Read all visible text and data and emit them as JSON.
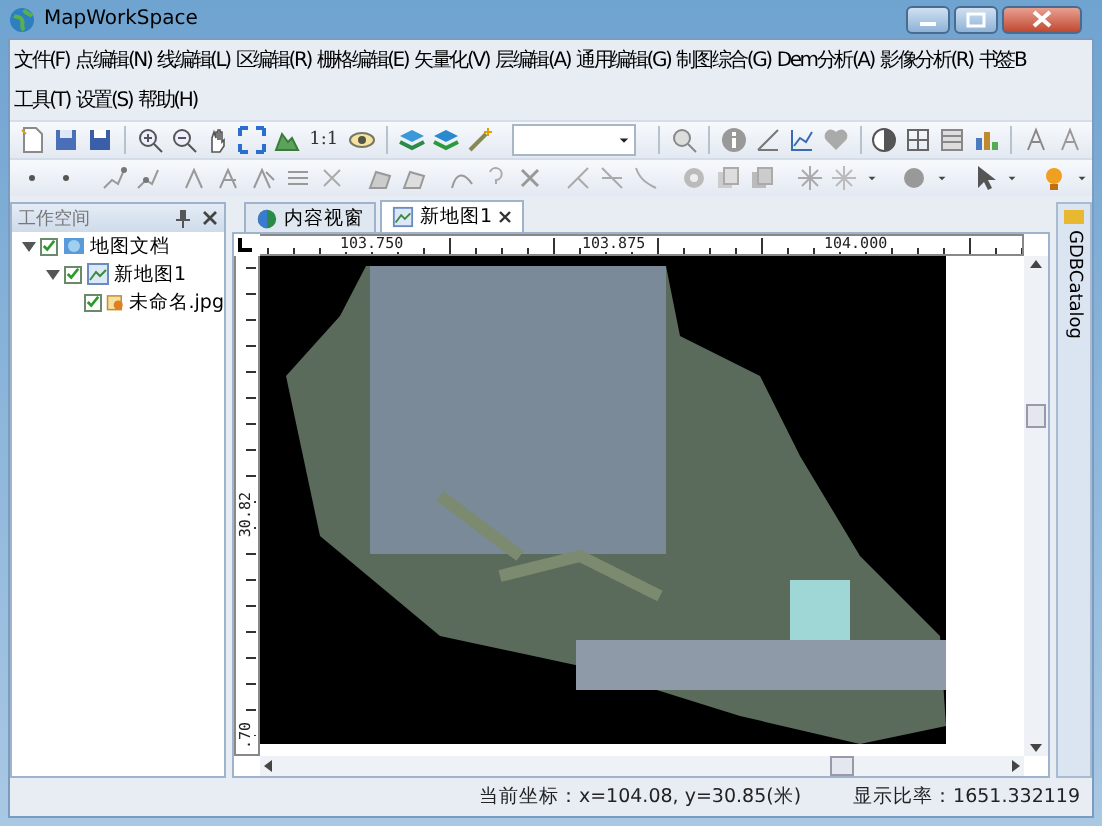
{
  "window": {
    "title": "MapWorkSpace"
  },
  "menu_rows": [
    [
      "文件(F)",
      "点编辑(N)",
      "线编辑(L)",
      "区编辑(R)",
      "栅格编辑(E)",
      "矢量化(V)",
      "层编辑(A)",
      "通用编辑(G)",
      "制图综合(G)",
      "Dem分析(A)",
      "影像分析(R)",
      "书签B"
    ],
    [
      "工具(T)",
      "设置(S)",
      "帮助(H)"
    ]
  ],
  "toolbar": {
    "scale_label": "1:1"
  },
  "workspace": {
    "title": "工作空间",
    "tree": [
      {
        "label": "地图文档",
        "checked": true,
        "expanded": true,
        "children": [
          {
            "label": "新地图1",
            "checked": true,
            "expanded": true,
            "children": [
              {
                "label": "未命名.jpg",
                "checked": true
              }
            ]
          }
        ]
      }
    ]
  },
  "tabs": [
    {
      "label": "内容视窗",
      "selected": false
    },
    {
      "label": "新地图1",
      "selected": true
    }
  ],
  "map": {
    "x_ruler": [
      "103.750",
      "103.875",
      "104.000"
    ],
    "y_ruler": [
      "30.82",
      ".70"
    ]
  },
  "side_tab": "GDBCatalog",
  "status": {
    "coords": "当前坐标：x=104.08, y=30.85(米)",
    "scale": "显示比率：1651.332119"
  }
}
